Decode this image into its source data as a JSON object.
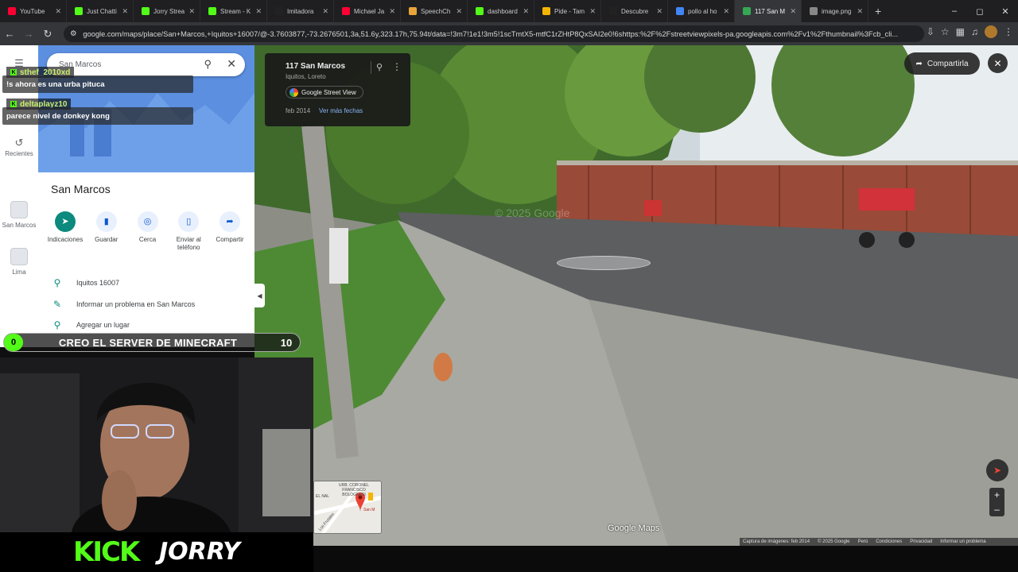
{
  "browser": {
    "tabs": [
      {
        "title": "YouTube",
        "color": "#ff0033",
        "active": false
      },
      {
        "title": "Just Chatti",
        "color": "#53fc18",
        "active": false
      },
      {
        "title": "Jorry Strea",
        "color": "#53fc18",
        "active": false
      },
      {
        "title": "Stream - K",
        "color": "#53fc18",
        "active": false
      },
      {
        "title": "Imitadora",
        "color": "#222222",
        "active": false
      },
      {
        "title": "Michael Ja",
        "color": "#ff0033",
        "active": false
      },
      {
        "title": "SpeechCh",
        "color": "#e8a33b",
        "active": false
      },
      {
        "title": "dashboard",
        "color": "#53fc18",
        "active": false
      },
      {
        "title": "Pide - Tam",
        "color": "#f5b400",
        "active": false
      },
      {
        "title": "Descubre",
        "color": "#222222",
        "active": false
      },
      {
        "title": "pollo al ho",
        "color": "#4285f4",
        "active": false
      },
      {
        "title": "117 San M",
        "color": "#34a853",
        "active": true
      },
      {
        "title": "image.png",
        "color": "#888888",
        "active": false
      }
    ],
    "url": "google.com/maps/place/San+Marcos,+Iquitos+16007/@-3.7603877,-73.2676501,3a,51.6y,323.17h,75.94t/data=!3m7!1e1!3m5!1scTmtX5-mtfC1rZHtP8QxSAI2e0!6shttps:%2F%2Fstreetviewpixels-pa.googleapis.com%2Fv1%2Fthumbnail%3Fcb_cli..."
  },
  "maps": {
    "search_value": "San Marcos",
    "rail": [
      {
        "label": "Recientes",
        "icon": "history-icon"
      },
      {
        "label": "San Marcos",
        "icon": "place-thumbnail"
      },
      {
        "label": "Lima",
        "icon": "place-thumbnail"
      }
    ],
    "place_title": "San Marcos",
    "actions": [
      {
        "label": "Indicaciones",
        "icon": "directions-icon"
      },
      {
        "label": "Guardar",
        "icon": "bookmark-icon"
      },
      {
        "label": "Cerca",
        "icon": "nearby-icon"
      },
      {
        "label": "Enviar al teléfono",
        "icon": "phone-icon"
      },
      {
        "label": "Compartir",
        "icon": "share-icon"
      }
    ],
    "info_rows": [
      {
        "text": "Iquitos 16007",
        "icon": "location-pin-icon"
      },
      {
        "text": "Informar un problema en San Marcos",
        "icon": "pencil-icon"
      },
      {
        "text": "Agregar un lugar",
        "icon": "add-place-icon"
      }
    ]
  },
  "streetview": {
    "address": "117 San Marcos",
    "locality": "Iquitos, Loreto",
    "badge": "Google Street View",
    "date": "feb 2014",
    "more_dates": "Ver más fechas",
    "share_label": "Compartirla",
    "watermark": "© 2025 Google",
    "logo": "Google Maps",
    "footer": [
      "Captura de imágenes: feb 2014",
      "© 2025 Google",
      "Perú",
      "Condiciones",
      "Privacidad",
      "Informar un problema"
    ],
    "minimap_labels": [
      "URB. CORONEL FRANCISCO BOLOGNESI",
      "EL NAL",
      "Los Frutales",
      "San M"
    ]
  },
  "stream": {
    "chat": [
      {
        "user": "sthef_2010xd",
        "message": "!s ahora es una urba pituca"
      },
      {
        "user": "deltaplayz10",
        "message": "parece nivel de donkey kong"
      }
    ],
    "poll": {
      "left_count": "0",
      "text": "CREO EL SERVER DE MINECRAFT",
      "right_count": "10"
    },
    "brand": "KICK",
    "streamer": "JORRY"
  },
  "colors": {
    "kick_green": "#53fc18",
    "maps_teal": "#0b8a7d",
    "accent_blue": "#8ab4f8"
  }
}
